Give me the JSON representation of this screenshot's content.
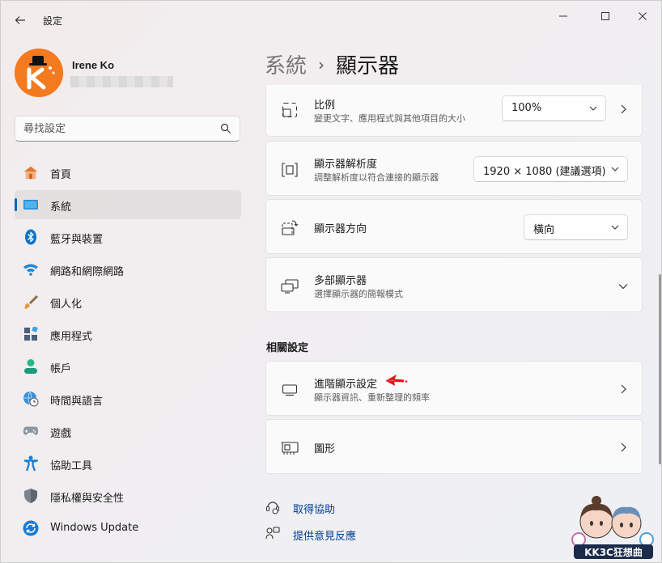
{
  "window": {
    "title": "設定"
  },
  "profile": {
    "name": "Irene Ko",
    "email": ""
  },
  "search": {
    "placeholder": "尋找設定"
  },
  "sidebar": {
    "items": [
      {
        "label": "首頁",
        "icon": "home-icon",
        "active": false
      },
      {
        "label": "系統",
        "icon": "system-icon",
        "active": true
      },
      {
        "label": "藍牙與裝置",
        "icon": "bluetooth-icon",
        "active": false
      },
      {
        "label": "網路和網際網路",
        "icon": "wifi-icon",
        "active": false
      },
      {
        "label": "個人化",
        "icon": "brush-icon",
        "active": false
      },
      {
        "label": "應用程式",
        "icon": "apps-icon",
        "active": false
      },
      {
        "label": "帳戶",
        "icon": "account-icon",
        "active": false
      },
      {
        "label": "時間與語言",
        "icon": "globe-clock-icon",
        "active": false
      },
      {
        "label": "遊戲",
        "icon": "gamepad-icon",
        "active": false
      },
      {
        "label": "協助工具",
        "icon": "accessibility-icon",
        "active": false
      },
      {
        "label": "隱私權與安全性",
        "icon": "shield-icon",
        "active": false
      },
      {
        "label": "Windows Update",
        "icon": "update-icon",
        "active": false
      }
    ]
  },
  "breadcrumb": {
    "parent": "系統",
    "separator": "›",
    "current": "顯示器"
  },
  "settings": {
    "scale": {
      "title": "比例",
      "subtitle": "變更文字、應用程式與其他項目的大小",
      "value": "100%"
    },
    "resolution": {
      "title": "顯示器解析度",
      "subtitle": "調整解析度以符合連接的顯示器",
      "value": "1920 × 1080 (建議選項)"
    },
    "orientation": {
      "title": "顯示器方向",
      "value": "橫向"
    },
    "multi": {
      "title": "多部顯示器",
      "subtitle": "選擇顯示器的簡報模式"
    }
  },
  "related": {
    "heading": "相關設定",
    "advanced": {
      "title": "進階顯示設定",
      "subtitle": "顯示器資訊、重新整理的頻率"
    },
    "graphics": {
      "title": "圖形"
    }
  },
  "links": {
    "help": "取得協助",
    "feedback": "提供意見反應"
  },
  "watermark": {
    "text": "KK3C狂想曲"
  },
  "colors": {
    "accent": "#0067c0",
    "annotation_arrow": "#e8141b"
  }
}
